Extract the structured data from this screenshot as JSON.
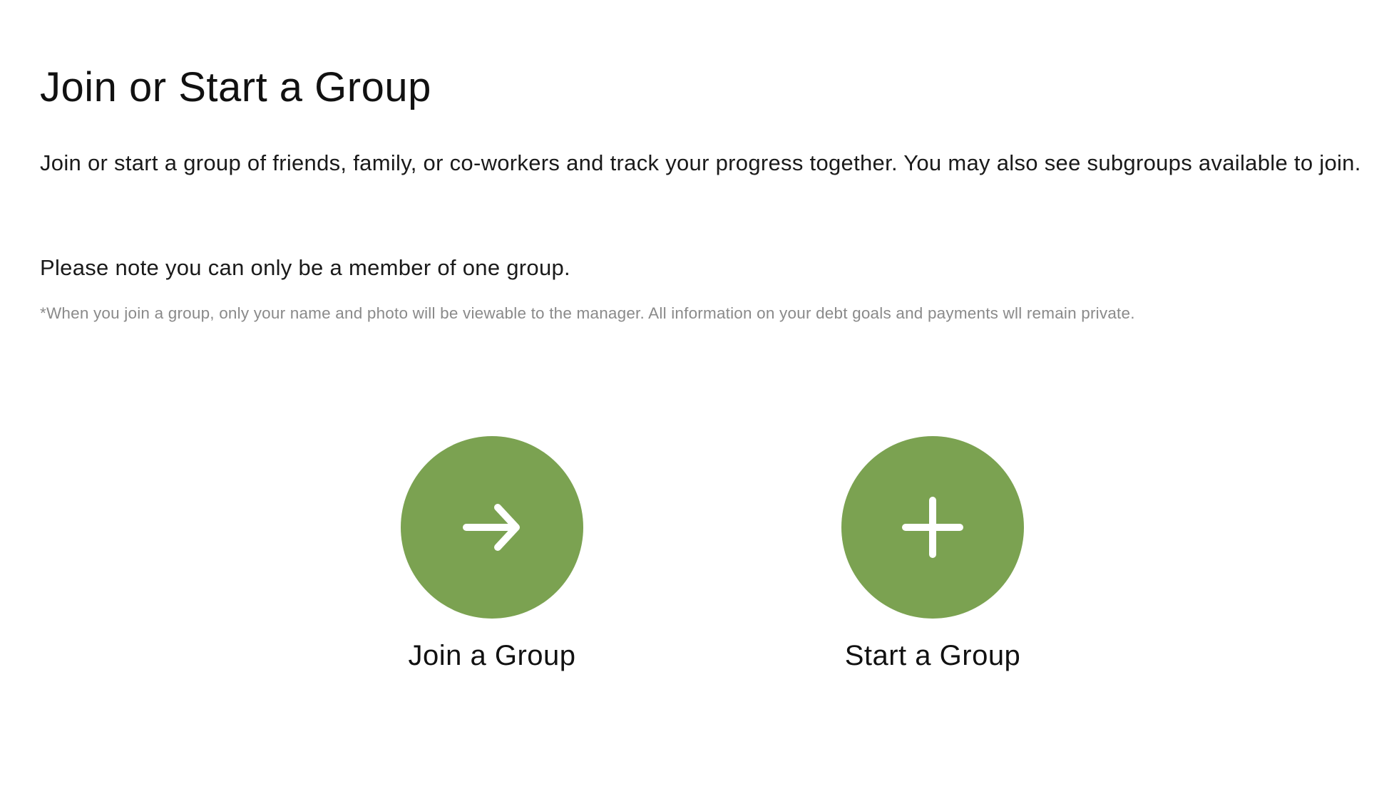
{
  "page": {
    "title": "Join or Start a Group",
    "intro": "Join or start a group of friends, family, or co-workers and track your progress together. You may also see subgroups available to join.",
    "note": "Please note you can only be a member of one group.",
    "disclaimer": "*When you join a group, only your name and photo will be viewable to the manager. All information on your debt goals and payments wll remain private."
  },
  "actions": {
    "join": {
      "label": "Join a Group",
      "icon": "arrow-right-icon"
    },
    "start": {
      "label": "Start a Group",
      "icon": "plus-icon"
    }
  },
  "colors": {
    "accent": "#7ba251",
    "text": "#111111",
    "muted": "#8a8a8a"
  }
}
